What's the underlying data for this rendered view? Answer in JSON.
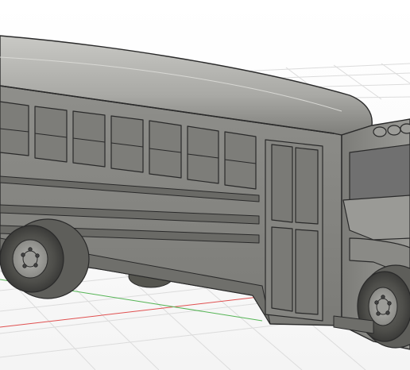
{
  "viewport": {
    "scene": "3d-model-canvas",
    "model": "school-bus",
    "background_color": "#ffffff",
    "grid_color": "#dcdcdc",
    "axis_x_color": "#e05050",
    "axis_z_color": "#55b455",
    "body_color": "#8a8a86",
    "outline_color": "#2a2a2a",
    "icons": [
      "wheel-icon",
      "headlight-icon"
    ]
  }
}
